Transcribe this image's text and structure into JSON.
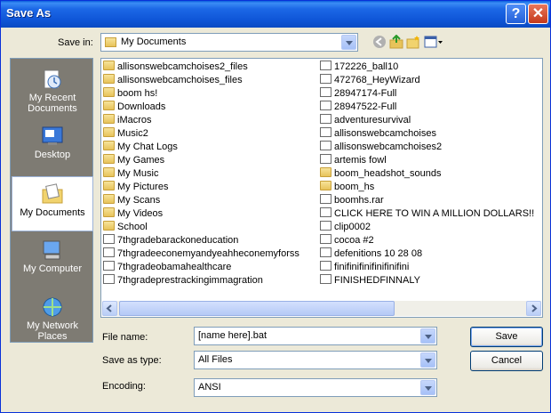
{
  "window": {
    "title": "Save As"
  },
  "toolbar": {
    "save_in_label": "Save in:",
    "save_in_value": "My Documents"
  },
  "places": [
    {
      "id": "recent",
      "label": "My Recent Documents",
      "icon": "recent-documents-icon"
    },
    {
      "id": "desktop",
      "label": "Desktop",
      "icon": "desktop-icon"
    },
    {
      "id": "mydocs",
      "label": "My Documents",
      "icon": "my-documents-icon",
      "active": true
    },
    {
      "id": "computer",
      "label": "My Computer",
      "icon": "my-computer-icon"
    },
    {
      "id": "network",
      "label": "My Network Places",
      "icon": "network-places-icon"
    }
  ],
  "files": {
    "col1": [
      {
        "name": "allisonswebcamchoises2_files",
        "type": "folder"
      },
      {
        "name": "allisonswebcamchoises_files",
        "type": "folder"
      },
      {
        "name": "boom hs!",
        "type": "folder"
      },
      {
        "name": "Downloads",
        "type": "folder"
      },
      {
        "name": "iMacros",
        "type": "folder"
      },
      {
        "name": "Music2",
        "type": "folder"
      },
      {
        "name": "My Chat Logs",
        "type": "folder"
      },
      {
        "name": "My Games",
        "type": "folder"
      },
      {
        "name": "My Music",
        "type": "folder"
      },
      {
        "name": "My Pictures",
        "type": "folder"
      },
      {
        "name": "My Scans",
        "type": "folder"
      },
      {
        "name": "My Videos",
        "type": "folder"
      },
      {
        "name": "School",
        "type": "folder"
      },
      {
        "name": "7thgradebarackoneducation",
        "type": "file"
      },
      {
        "name": "7thgradeeconemyandyeahheconemyforss",
        "type": "file"
      },
      {
        "name": "7thgradeobamahealthcare",
        "type": "file"
      },
      {
        "name": "7thgradeprestrackingimmagration",
        "type": "file"
      }
    ],
    "col2": [
      {
        "name": "172226_ball10",
        "type": "file"
      },
      {
        "name": "472768_HeyWizard",
        "type": "file"
      },
      {
        "name": "28947174-Full",
        "type": "file"
      },
      {
        "name": "28947522-Full",
        "type": "file"
      },
      {
        "name": "adventuresurvival",
        "type": "file"
      },
      {
        "name": "allisonswebcamchoises",
        "type": "file"
      },
      {
        "name": "allisonswebcamchoises2",
        "type": "file"
      },
      {
        "name": "artemis fowl",
        "type": "file"
      },
      {
        "name": "boom_headshot_sounds",
        "type": "folder"
      },
      {
        "name": "boom_hs",
        "type": "folder"
      },
      {
        "name": "boomhs.rar",
        "type": "file"
      },
      {
        "name": "CLICK HERE TO WIN A MILLION DOLLARS!!",
        "type": "file"
      },
      {
        "name": "clip0002",
        "type": "file"
      },
      {
        "name": "cocoa #2",
        "type": "file"
      },
      {
        "name": "defenitions 10 28 08",
        "type": "file"
      },
      {
        "name": "finifinifinifinifinifini",
        "type": "file"
      },
      {
        "name": "FINISHEDFINNALY",
        "type": "file"
      }
    ]
  },
  "form": {
    "filename_label": "File name:",
    "filename_value": "[name here].bat",
    "savetype_label": "Save as type:",
    "savetype_value": "All Files",
    "encoding_label": "Encoding:",
    "encoding_value": "ANSI"
  },
  "buttons": {
    "save": "Save",
    "cancel": "Cancel"
  },
  "titlebar_buttons": {
    "help": "?",
    "close": "✕"
  }
}
